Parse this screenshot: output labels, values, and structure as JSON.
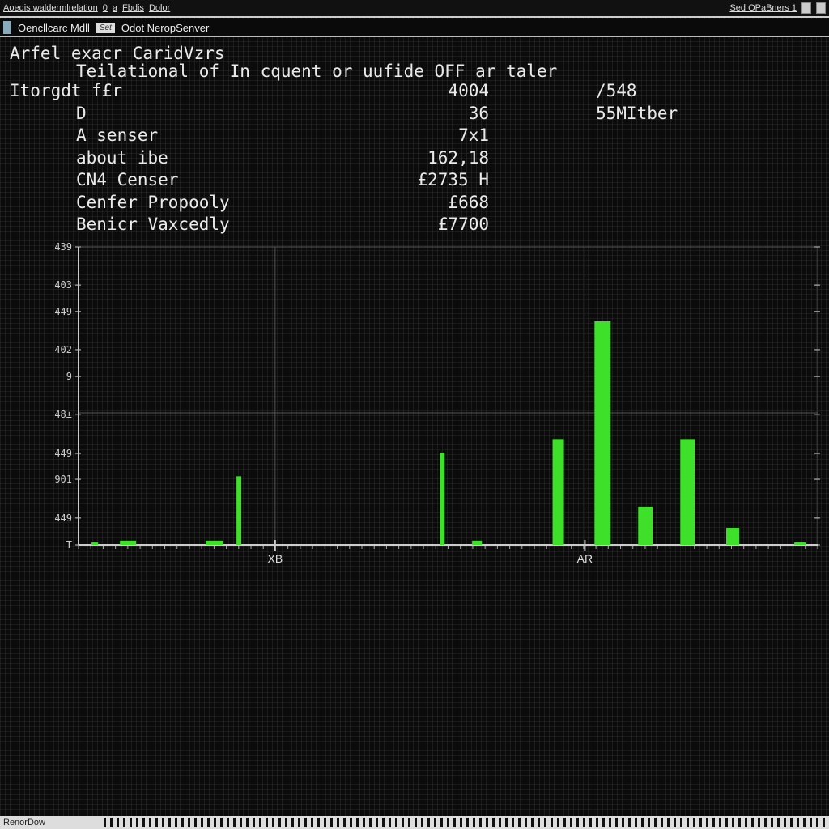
{
  "titlebar": {
    "title": "Aoedis waldermlrelation",
    "items": [
      "0",
      "a",
      "Fbdis",
      "Dolor"
    ],
    "right": "Sed OPaBners 1"
  },
  "tabs": [
    {
      "label": "Oencllcarc Mdll"
    },
    {
      "label": "Set",
      "selected": true
    },
    {
      "label": "Odot NeropSenver"
    }
  ],
  "output": {
    "header": "Arfel exacr CaridVzrs",
    "subheader": "Teilational of In cquent or uufide OFF ar taler",
    "rows": [
      {
        "label": "Itorgdt f£r",
        "value": "4004",
        "extra": "/548",
        "indent": false
      },
      {
        "label": "D",
        "value": "36",
        "extra": "55MItber",
        "indent": true
      },
      {
        "label": "A senser",
        "value": "7x1",
        "extra": "",
        "indent": true
      },
      {
        "label": "about ibe",
        "value": "162,18",
        "extra": "",
        "indent": true
      },
      {
        "label": "CN4 Censer",
        "value": "£2735 H",
        "extra": "",
        "indent": true
      },
      {
        "label": "Cenfer Propooly",
        "value": "£668",
        "extra": "",
        "indent": true
      },
      {
        "label": "Benicr Vaxcedly",
        "value": "£7700",
        "extra": "",
        "indent": true
      }
    ]
  },
  "chart_data": {
    "type": "bar",
    "bar_color": "#3ee02a",
    "axis_color": "#cccccc",
    "grid": true,
    "ytick_labels": [
      "439",
      "403",
      "449",
      "402",
      "9",
      "48±",
      "449",
      "901",
      "449",
      "T"
    ],
    "xtick_labels": [
      {
        "label": "XB",
        "x": 26.6
      },
      {
        "label": "AR",
        "x": 68.5
      }
    ],
    "xlim": [
      0,
      100
    ],
    "ylim": [
      0,
      1
    ],
    "bars": [
      {
        "x": 2.2,
        "value": 0.008
      },
      {
        "x": 6.7,
        "value": 0.014
      },
      {
        "x": 18.4,
        "value": 0.014
      },
      {
        "x": 21.7,
        "value": 0.23
      },
      {
        "x": 49.2,
        "value": 0.31
      },
      {
        "x": 53.9,
        "value": 0.014
      },
      {
        "x": 64.9,
        "value": 0.355
      },
      {
        "x": 70.9,
        "value": 0.75
      },
      {
        "x": 76.7,
        "value": 0.128
      },
      {
        "x": 82.4,
        "value": 0.355
      },
      {
        "x": 88.5,
        "value": 0.057
      },
      {
        "x": 97.6,
        "value": 0.008
      }
    ]
  },
  "status": {
    "label": "RenorDow"
  }
}
